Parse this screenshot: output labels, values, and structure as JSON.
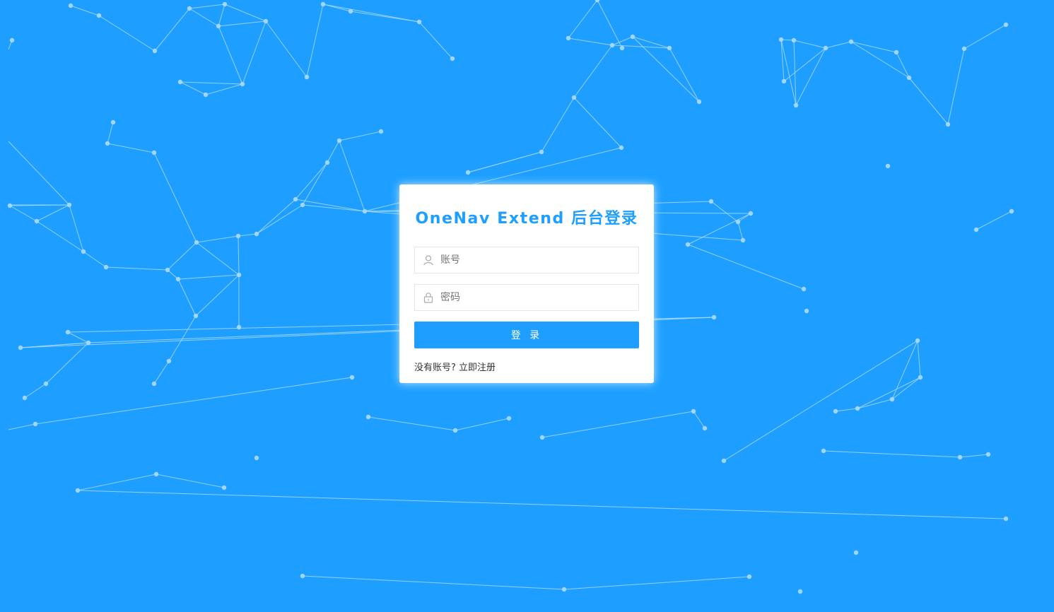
{
  "background": {
    "color": "#1e9fff",
    "line_color": "#a8d8ff"
  },
  "login": {
    "title": "OneNav Extend 后台登录",
    "username_placeholder": "账号",
    "password_placeholder": "密码",
    "submit_label": "登 录",
    "no_account_text": "没有账号?",
    "register_link": "立即注册",
    "accent_color": "#1e9fff"
  },
  "icons": {
    "username": "user-icon",
    "password": "lock-icon"
  }
}
